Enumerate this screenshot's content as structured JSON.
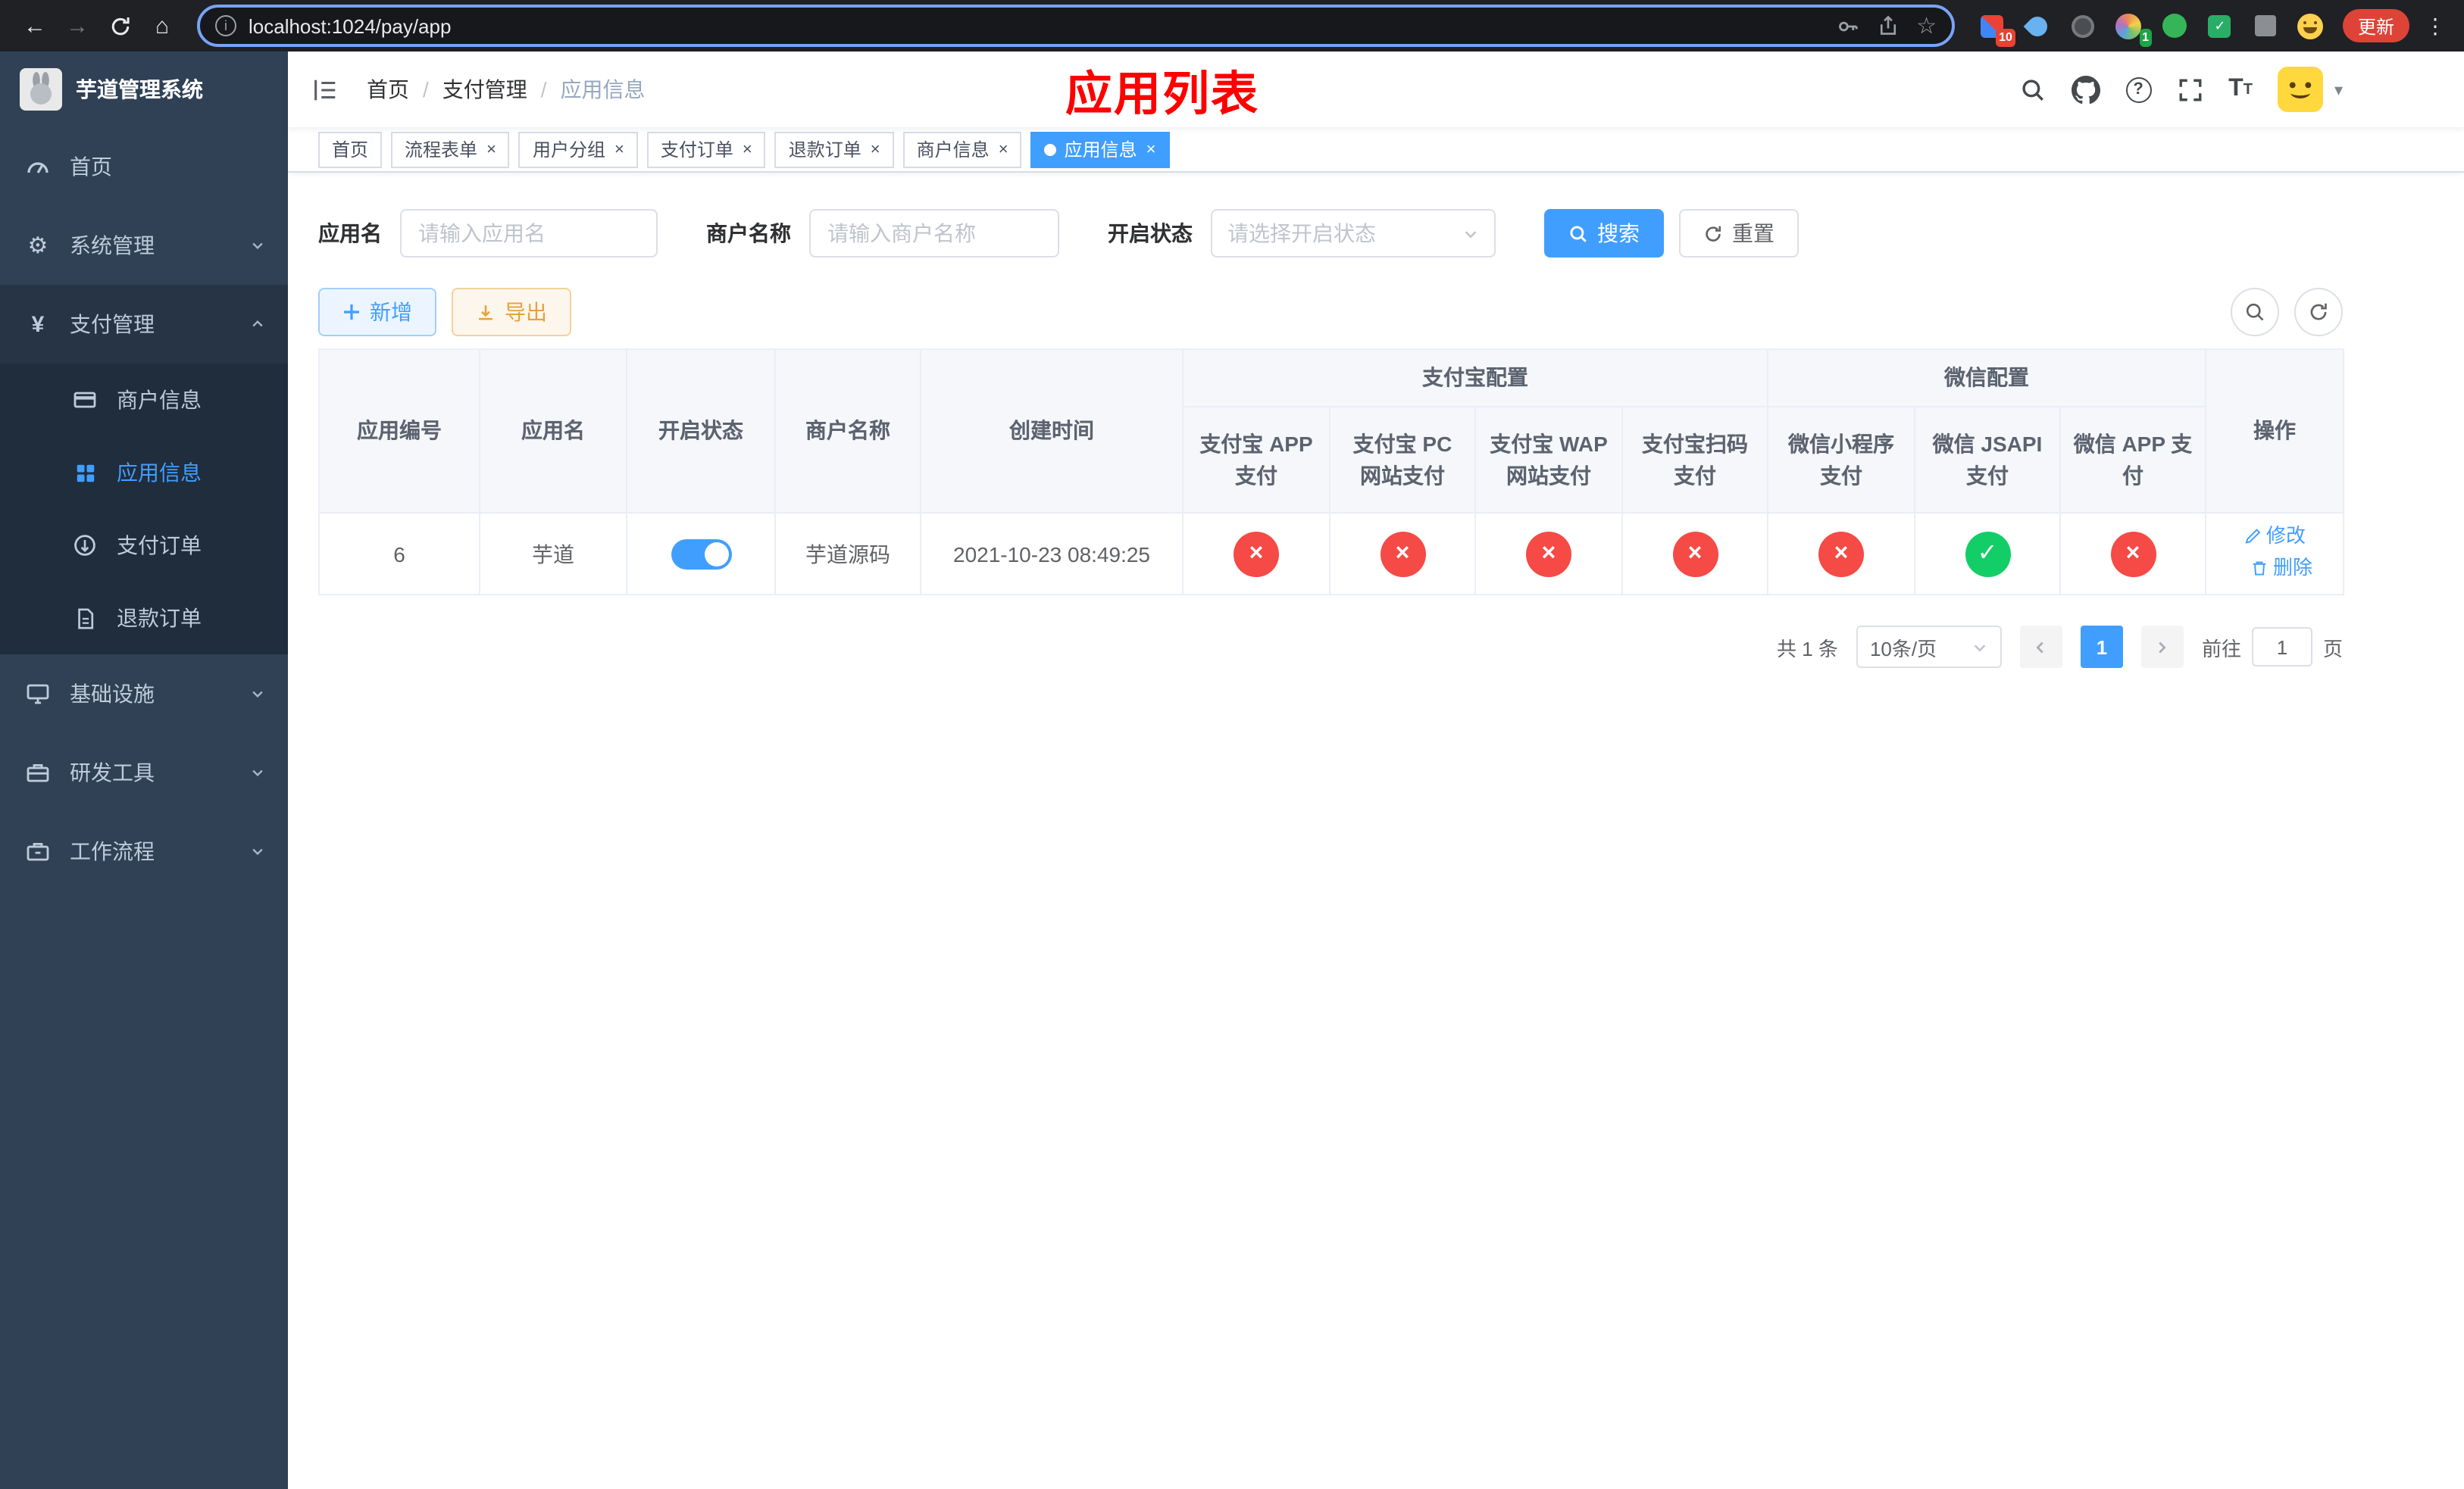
{
  "browser": {
    "url": "localhost:1024/pay/app",
    "update_label": "更新",
    "ext_badge_10": "10",
    "ext_badge_1": "1"
  },
  "sidebar": {
    "title": "芋道管理系统",
    "menu": [
      {
        "label": "首页"
      },
      {
        "label": "系统管理"
      },
      {
        "label": "支付管理"
      },
      {
        "label": "基础设施"
      },
      {
        "label": "研发工具"
      },
      {
        "label": "工作流程"
      }
    ],
    "submenu": [
      {
        "label": "商户信息"
      },
      {
        "label": "应用信息"
      },
      {
        "label": "支付订单"
      },
      {
        "label": "退款订单"
      }
    ]
  },
  "navbar": {
    "breadcrumb": [
      "首页",
      "支付管理",
      "应用信息"
    ],
    "page_title": "应用列表"
  },
  "tabs": [
    {
      "label": "首页"
    },
    {
      "label": "流程表单"
    },
    {
      "label": "用户分组"
    },
    {
      "label": "支付订单"
    },
    {
      "label": "退款订单"
    },
    {
      "label": "商户信息"
    },
    {
      "label": "应用信息"
    }
  ],
  "filters": {
    "app_name_label": "应用名",
    "app_name_placeholder": "请输入应用名",
    "merchant_label": "商户名称",
    "merchant_placeholder": "请输入商户名称",
    "status_label": "开启状态",
    "status_placeholder": "请选择开启状态",
    "search_label": "搜索",
    "reset_label": "重置"
  },
  "toolbar": {
    "add_label": "新增",
    "export_label": "导出"
  },
  "table": {
    "headers": {
      "app_id": "应用编号",
      "app_name": "应用名",
      "status": "开启状态",
      "merchant": "商户名称",
      "created": "创建时间",
      "alipay_group": "支付宝配置",
      "wechat_group": "微信配置",
      "actions": "操作",
      "sub": [
        "支付宝 APP 支付",
        "支付宝 PC 网站支付",
        "支付宝 WAP 网站支付",
        "支付宝扫码支付",
        "微信小程序支付",
        "微信 JSAPI 支付",
        "微信 APP 支付"
      ]
    },
    "row": {
      "app_id": "6",
      "app_name": "芋道",
      "status_on": true,
      "merchant": "芋道源码",
      "created": "2021-10-23 08:49:25",
      "configs": [
        false,
        false,
        false,
        false,
        false,
        true,
        false
      ],
      "edit_label": "修改",
      "delete_label": "删除"
    }
  },
  "pagination": {
    "total": "共 1 条",
    "page_size": "10条/页",
    "current_page": "1",
    "goto_label": "前往",
    "goto_value": "1",
    "goto_unit": "页"
  },
  "colors": {
    "accent": "#409eff",
    "danger": "#f54a45",
    "success": "#13ce66",
    "sidebar_bg": "#304156",
    "title_red": "#ff0000"
  }
}
